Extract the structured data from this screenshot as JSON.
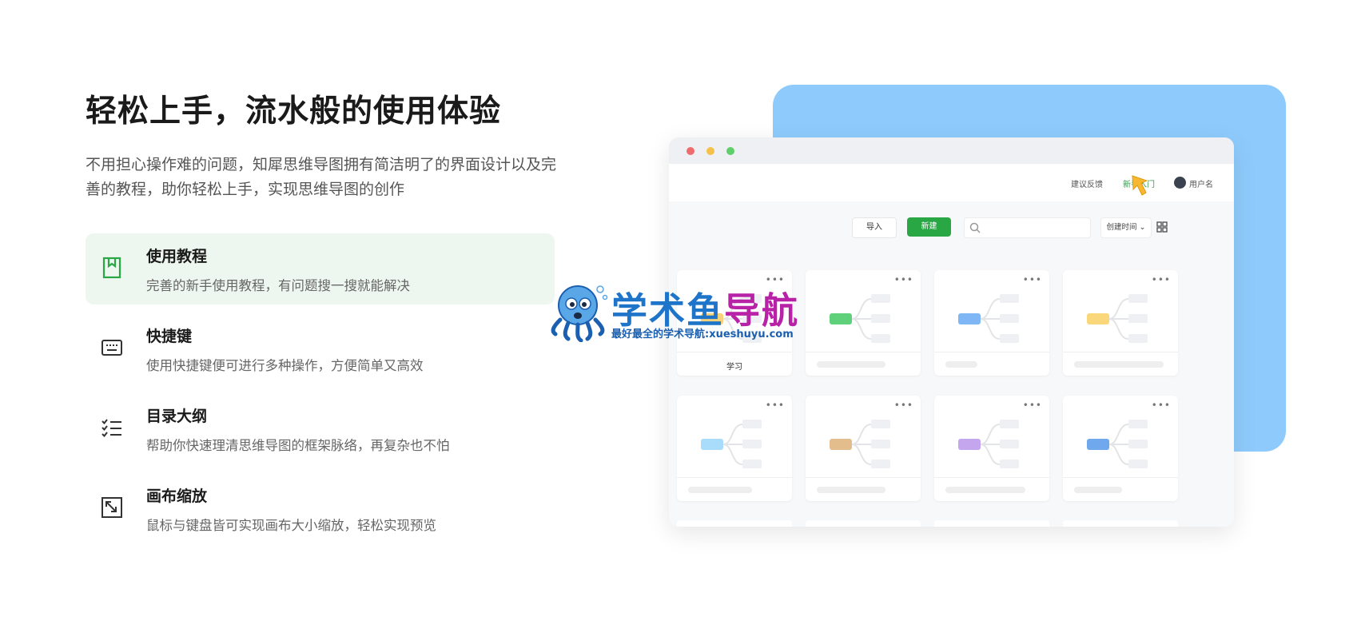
{
  "hero": {
    "title": "轻松上手，流水般的使用体验",
    "description": "不用担心操作难的问题，知犀思维导图拥有简洁明了的界面设计以及完善的教程，助你轻松上手，实现思维导图的创作"
  },
  "features": [
    {
      "title": "使用教程",
      "description": "完善的新手使用教程，有问题搜一搜就能解决",
      "icon": "bookmark-icon",
      "active": true
    },
    {
      "title": "快捷键",
      "description": "使用快捷键便可进行多种操作，方便简单又高效",
      "icon": "keyboard-icon",
      "active": false
    },
    {
      "title": "目录大纲",
      "description": "帮助你快速理清思维导图的框架脉络，再复杂也不怕",
      "icon": "checklist-icon",
      "active": false
    },
    {
      "title": "画布缩放",
      "description": "鼠标与键盘皆可实现画布大小缩放，轻松实现预览",
      "icon": "zoom-icon",
      "active": false
    }
  ],
  "app": {
    "topbar": {
      "feedback": "建议反馈",
      "beginner": "新手入门",
      "user": "用户名"
    },
    "toolbar": {
      "import": "导入",
      "new": "新建",
      "sort": "创建时间"
    },
    "cards": [
      {
        "name": "学习",
        "color": "#f7d27a"
      },
      {
        "name": "",
        "color": "#5fd17a"
      },
      {
        "name": "",
        "color": "#7eb6f6"
      },
      {
        "name": "",
        "color": "#f9d77a"
      },
      {
        "name": "",
        "color": "#a9dbfb"
      },
      {
        "name": "",
        "color": "#e3be8c"
      },
      {
        "name": "",
        "color": "#c4a6ef"
      },
      {
        "name": "",
        "color": "#6fa8ec"
      }
    ]
  },
  "watermark": {
    "brand_a": "学术鱼",
    "brand_b": "导航",
    "subtitle": "最好最全的学术导航:xueshuyu.com"
  },
  "colors": {
    "accent": "#29a745",
    "active_bg": "#eef7ef",
    "blue_card": "#8ecbfc"
  }
}
